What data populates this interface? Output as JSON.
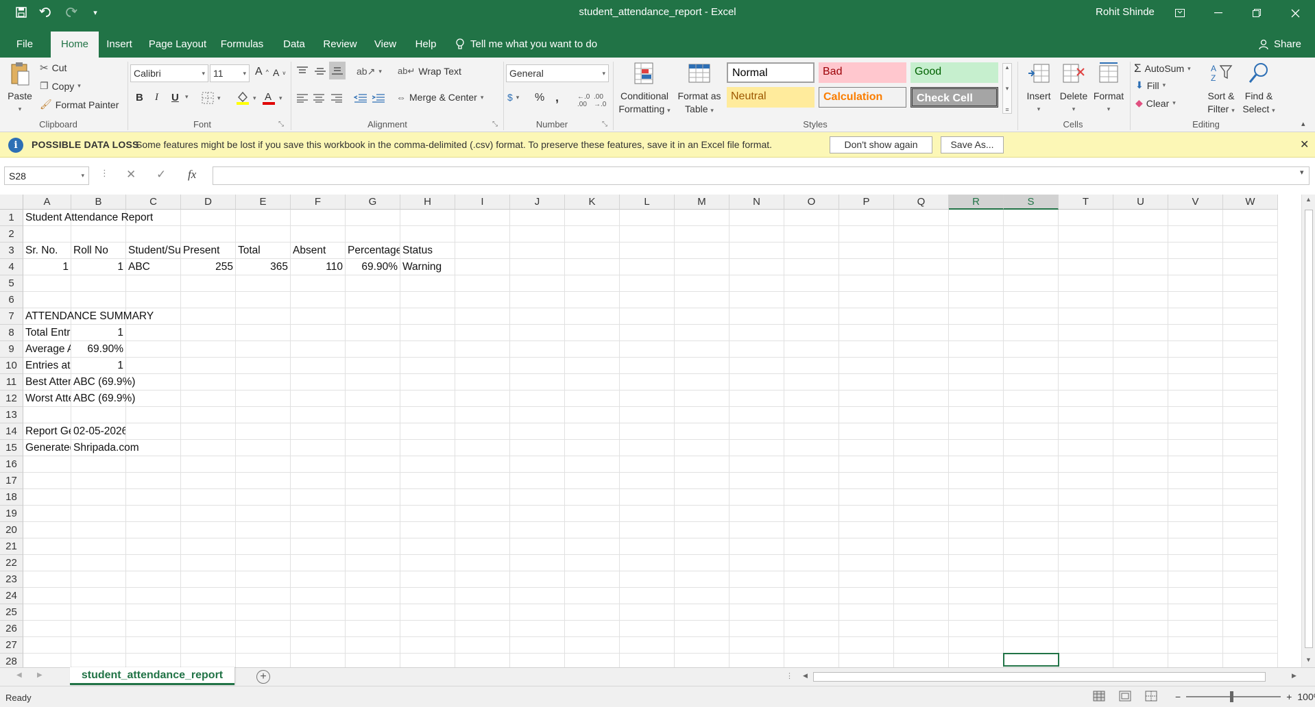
{
  "window": {
    "title": "student_attendance_report  -  Excel",
    "user": "Rohit Shinde",
    "accent": "#217346"
  },
  "tabs": [
    "File",
    "Home",
    "Insert",
    "Page Layout",
    "Formulas",
    "Data",
    "Review",
    "View",
    "Help"
  ],
  "tell_me": "Tell me what you want to do",
  "share": "Share",
  "ribbon": {
    "clipboard": {
      "label": "Clipboard",
      "paste": "Paste",
      "cut": "Cut",
      "copy": "Copy",
      "format_painter": "Format Painter"
    },
    "font": {
      "label": "Font",
      "name": "Calibri",
      "size": "11",
      "bold": "B",
      "italic": "I",
      "underline": "U"
    },
    "alignment": {
      "label": "Alignment",
      "wrap_text": "Wrap Text",
      "merge_center": "Merge & Center"
    },
    "number": {
      "label": "Number",
      "format": "General",
      "percent": "%",
      "comma": ","
    },
    "styles": {
      "label": "Styles",
      "conditional_formatting": [
        "Conditional",
        "Formatting"
      ],
      "format_as_table": [
        "Format as",
        "Table"
      ],
      "normal": "Normal",
      "bad": "Bad",
      "good": "Good",
      "neutral": "Neutral",
      "calculation": "Calculation",
      "check_cell": "Check Cell"
    },
    "cells": {
      "label": "Cells",
      "insert": "Insert",
      "delete": "Delete",
      "format": "Format"
    },
    "editing": {
      "label": "Editing",
      "autosum": "AutoSum",
      "fill": "Fill",
      "clear": "Clear",
      "sort_filter": [
        "Sort &",
        "Filter"
      ],
      "find_select": [
        "Find &",
        "Select"
      ]
    }
  },
  "message_bar": {
    "title": "POSSIBLE DATA LOSS",
    "text": "Some features might be lost if you save this workbook in the comma-delimited (.csv) format. To preserve these features, save it in an Excel file format.",
    "dont_show": "Don't show again",
    "save_as": "Save As..."
  },
  "formula_bar": {
    "name_box": "S28",
    "fx": "fx",
    "value": ""
  },
  "columns": [
    "A",
    "B",
    "C",
    "D",
    "E",
    "F",
    "G",
    "H",
    "I",
    "J",
    "K",
    "L",
    "M",
    "N",
    "O",
    "P",
    "Q",
    "R",
    "S",
    "T",
    "U",
    "V",
    "W"
  ],
  "rows": [
    "1",
    "2",
    "3",
    "4",
    "5",
    "6",
    "7",
    "8",
    "9",
    "10",
    "11",
    "12",
    "13",
    "14",
    "15",
    "16",
    "17",
    "18",
    "19",
    "20",
    "21",
    "22",
    "23",
    "24",
    "25",
    "26",
    "27",
    "28"
  ],
  "cells": {
    "A1": "Student Attendance Report",
    "A3": "Sr. No.",
    "B3": "Roll No",
    "C3": "Student/Su",
    "D3": "Present",
    "E3": "Total",
    "F3": "Absent",
    "G3": "Percentage",
    "H3": "Status",
    "A4": "1",
    "B4": "1",
    "C4": "ABC",
    "D4": "255",
    "E4": "365",
    "F4": "110",
    "G4": "69.90%",
    "H4": "Warning",
    "A7": "ATTENDANCE SUMMARY",
    "A8": "Total Entri",
    "B8": "1",
    "A9": "Average At",
    "B9": "69.90%",
    "A10": "Entries at l",
    "B10": "1",
    "A11": "Best Atten",
    "B11": "ABC (69.9%)",
    "A12": "Worst Atte",
    "B12": "ABC (69.9%)",
    "A14": "Report Ge",
    "B14": "02-05-2026",
    "A15": "Generated",
    "B15": "Shripada.com"
  },
  "sheet_tab": "student_attendance_report",
  "status": {
    "ready": "Ready",
    "zoom": "100%"
  }
}
